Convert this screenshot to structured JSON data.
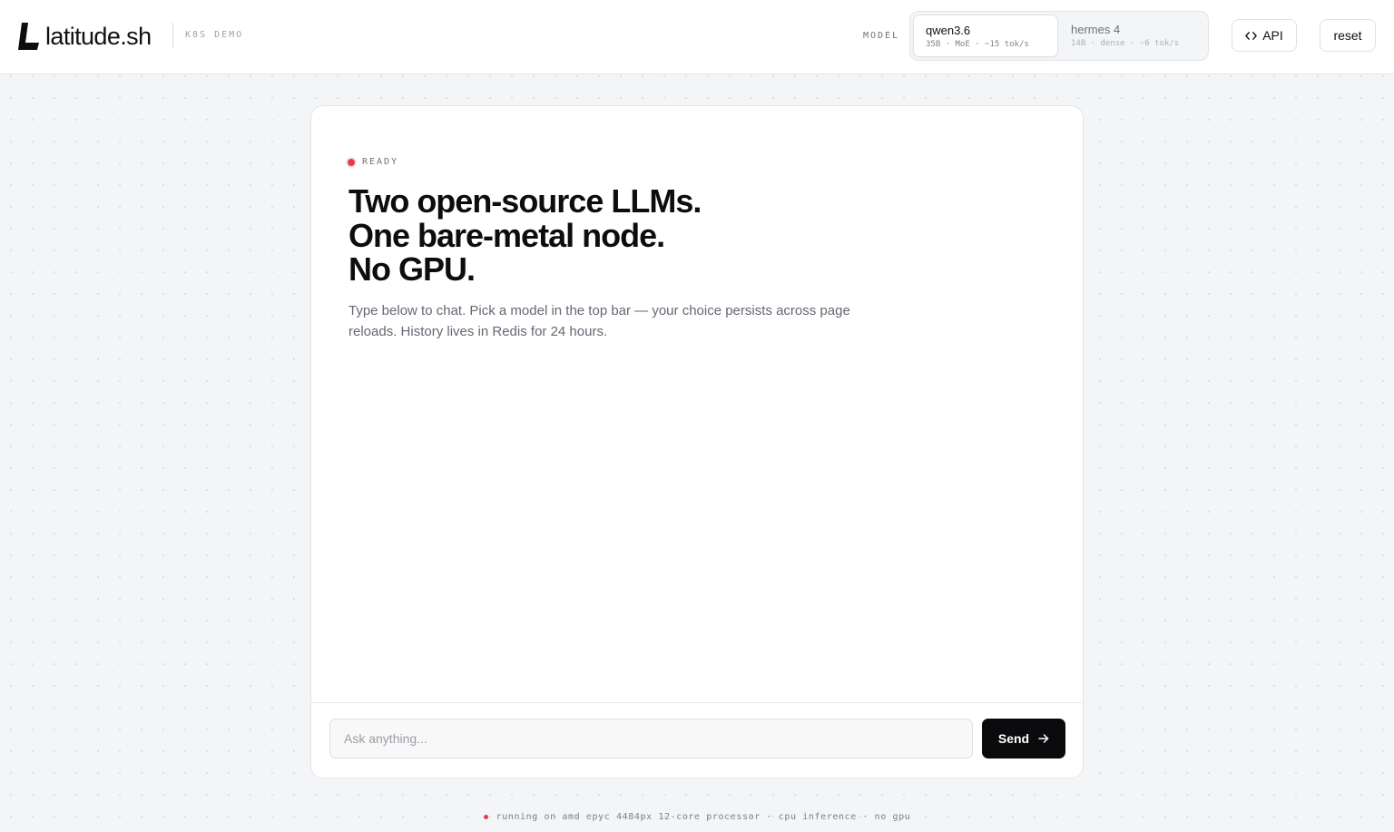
{
  "header": {
    "brand": "latitude.sh",
    "tag": "K8S DEMO",
    "model_label": "MODEL",
    "models": [
      {
        "name": "qwen3.6",
        "meta": "35B · MoE · ~15 tok/s",
        "selected": true
      },
      {
        "name": "hermes 4",
        "meta": "14B · dense · ~6 tok/s",
        "selected": false
      }
    ],
    "api_label": "API",
    "reset_label": "reset"
  },
  "card": {
    "status": "READY",
    "headline": [
      "Two open-source LLMs.",
      "One bare-metal node.",
      "No GPU."
    ],
    "subtext": "Type below to chat. Pick a model in the top bar — your choice persists across page reloads. History lives in Redis for 24 hours."
  },
  "composer": {
    "placeholder": "Ask anything...",
    "send_label": "Send"
  },
  "footer": {
    "text": "running on amd epyc 4484px 12-core processor · cpu inference · no gpu"
  },
  "colors": {
    "accent": "#e23b4f",
    "send_button": "#0b0b0d",
    "page_bg": "#f4f5f7"
  },
  "icons": {
    "logo": "latitude-logo-icon",
    "api": "code-icon",
    "send": "arrow-right-icon",
    "status": "status-dot-icon"
  }
}
